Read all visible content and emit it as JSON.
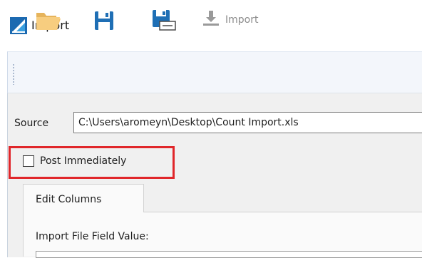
{
  "window": {
    "title": "Import",
    "app_icon": "app-logo-icon"
  },
  "toolbar": {
    "buttons": [
      {
        "icon": "open-folder-icon"
      },
      {
        "icon": "save-icon"
      },
      {
        "icon": "save-as-icon"
      }
    ],
    "import_label": "Import",
    "import_icon": "download-icon"
  },
  "source": {
    "label": "Source",
    "value": "C:\\Users\\aromeyn\\Desktop\\Count Import.xls"
  },
  "post_immediately": {
    "label": "Post Immediately",
    "checked": false
  },
  "tabs": [
    {
      "label": "Edit Columns"
    }
  ],
  "edit_columns": {
    "field_label": "Import File Field Value:"
  },
  "colors": {
    "highlight": "#e0262a",
    "accent": "#1f6fb5"
  }
}
